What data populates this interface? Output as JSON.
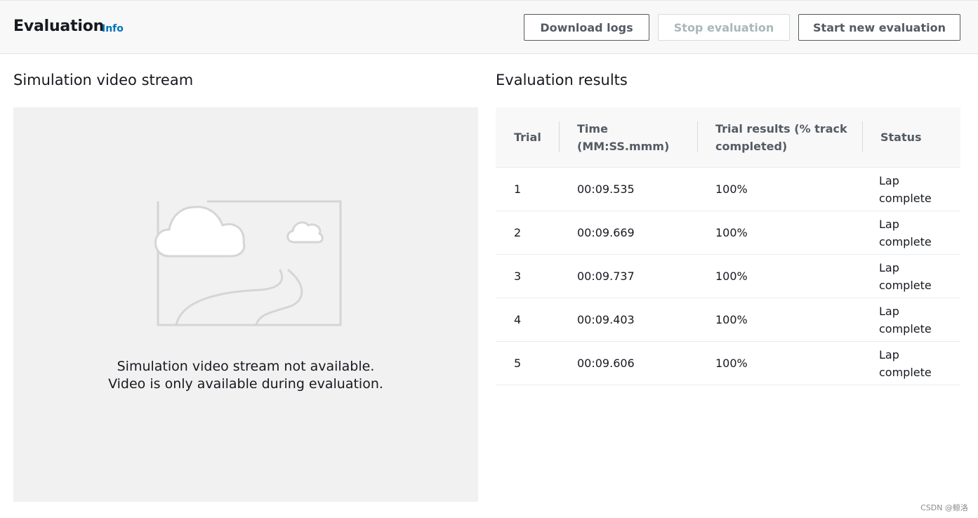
{
  "header": {
    "title": "Evaluation",
    "info_link": "Info",
    "buttons": {
      "download_logs": "Download logs",
      "stop_evaluation": "Stop evaluation",
      "start_new_evaluation": "Start new evaluation"
    }
  },
  "video": {
    "section_title": "Simulation video stream",
    "placeholder_icon": "image-placeholder-icon",
    "message_line1": "Simulation video stream not available.",
    "message_line2": "Video is only available during evaluation."
  },
  "results": {
    "section_title": "Evaluation results",
    "columns": {
      "trial": "Trial",
      "time_line1": "Time",
      "time_line2": "(MM:SS.mmm)",
      "trial_results_line1": "Trial results (% track",
      "trial_results_line2": "completed)",
      "status": "Status"
    },
    "rows": [
      {
        "trial": "1",
        "time": "00:09.535",
        "result": "100%",
        "status_line1": "Lap",
        "status_line2": "complete"
      },
      {
        "trial": "2",
        "time": "00:09.669",
        "result": "100%",
        "status_line1": "Lap",
        "status_line2": "complete"
      },
      {
        "trial": "3",
        "time": "00:09.737",
        "result": "100%",
        "status_line1": "Lap",
        "status_line2": "complete"
      },
      {
        "trial": "4",
        "time": "00:09.403",
        "result": "100%",
        "status_line1": "Lap",
        "status_line2": "complete"
      },
      {
        "trial": "5",
        "time": "00:09.606",
        "result": "100%",
        "status_line1": "Lap",
        "status_line2": "complete"
      }
    ]
  },
  "watermark": "CSDN @鲸洛",
  "colors": {
    "accent_link": "#0073bb",
    "header_bg": "#f8f8f8",
    "video_panel_bg": "#f1f1f1",
    "disabled_text": "#aab7b8"
  }
}
